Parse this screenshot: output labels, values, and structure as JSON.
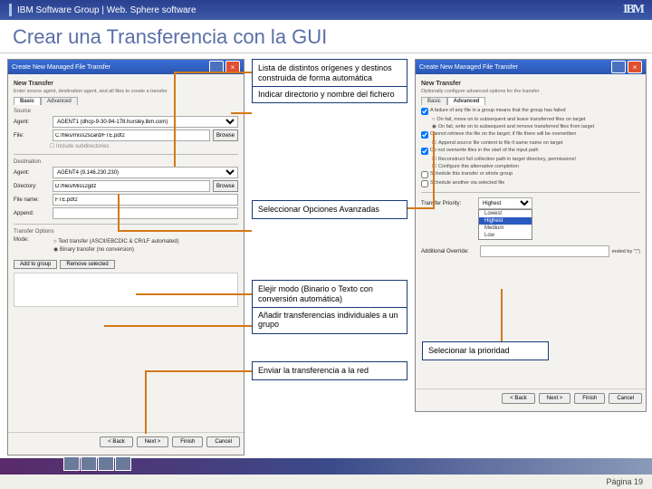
{
  "header": {
    "text": "IBM Software Group | Web. Sphere software",
    "logo": "IBM"
  },
  "title": "Crear una Transferencia con la GUI",
  "leftWin": {
    "title": "Create New Managed File Transfer",
    "heading": "New Transfer",
    "sub": "Enter source agent, destination agent, and all files to create a transfer",
    "tabBasic": "Basic",
    "tabAdv": "Advanced",
    "src": "Source",
    "agentLbl": "Agent:",
    "agentVal": "AGENT1 (dhcp-9-30-94-178.hursley.ibm.com)",
    "fileLbl": "File:",
    "fileVal": "C:/files/miss2scard/FTE.pdf2",
    "browse": "Browse",
    "includeSub": "Include subdirectories",
    "dst": "Destination",
    "agent2Val": "AGENT4 (9.146.230.230)",
    "dirLbl": "Directory:",
    "dirVal": "D:/files/Miss2gdz",
    "fnameLbl": "File name:",
    "fnameVal": "FTE.pdf2",
    "apLbl": "Append:",
    "opts": "Transfer Options",
    "modeLbl": "Mode:",
    "r1": "Text transfer (ASCII/EBCDIC & CR/LF automated)",
    "r2": "Binary transfer (no conversion)",
    "addGrp": "Add to group",
    "remSel": "Remove selected",
    "back": "< Back",
    "next": "Next >",
    "finish": "Finish",
    "cancel": "Cancel"
  },
  "rightWin": {
    "title": "Create New Managed File Transfer",
    "heading": "New Transfer",
    "sub": "Optionally configure advanced options for the transfer",
    "c1": "A failure of any file in a group means that the group has failed",
    "c1a": "On fail, move on to subsequent and leave transferred files on target",
    "c1b": "On fail, write on to subsequent and remove transferred files from target",
    "c2": "Cannot retrieve the file on the target; if file there will be overwritten",
    "c2a": "Append source file content to file if same name on target",
    "c3": "Do not overwrite files in the start of the input path",
    "c3a": "Reconstruct full collection path in target directory, permissions!",
    "c3b": "Configure this alternative completion",
    "c4": "Schedule this transfer or whole group",
    "c5": "Schedule another via selected file",
    "prioLbl": "Transfer Priority:",
    "prioSel": "Highest",
    "opts": [
      "Lowest",
      "Highest",
      "Medium",
      "Low"
    ],
    "addLbl": "Additional Override:",
    "addHint": "ended by \";\")"
  },
  "ann1a": "Lista de distintos orígenes y destinos construida de forma automática",
  "ann1b": "Indicar directorio y nombre del fichero",
  "ann2": "Seleccionar Opciones Avanzadas",
  "ann3a": "Elejir modo (Binario o Texto con conversión automática)",
  "ann3b": "Añadir transferencias individuales a un grupo",
  "ann4": "Selecionar la prioridad",
  "ann5": "Enviar la transferencia a la red",
  "footer": "Página 19"
}
